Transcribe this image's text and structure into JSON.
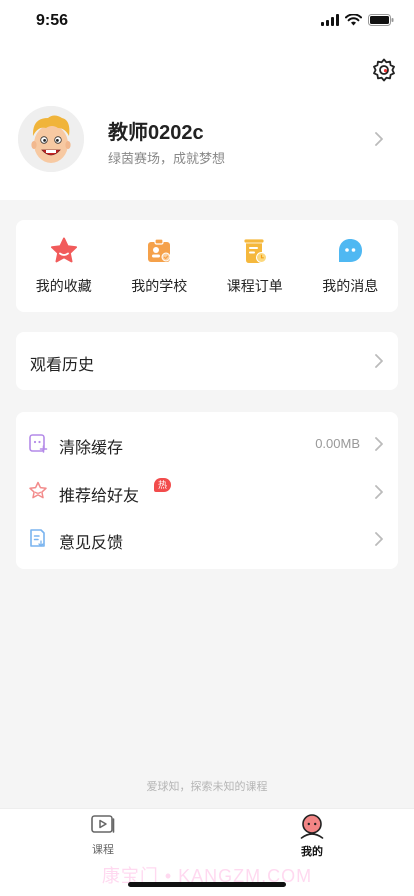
{
  "status_bar": {
    "time": "9:56"
  },
  "profile": {
    "name": "教师0202c",
    "subtitle": "绿茵赛场，成就梦想"
  },
  "quick_actions": [
    {
      "label": "我的收藏",
      "icon": "star-icon",
      "color": "#f15b5b"
    },
    {
      "label": "我的学校",
      "icon": "school-icon",
      "color": "#f5a14a"
    },
    {
      "label": "课程订单",
      "icon": "order-icon",
      "color": "#f5b83d"
    },
    {
      "label": "我的消息",
      "icon": "message-icon",
      "color": "#4fb8f2"
    }
  ],
  "history": {
    "label": "观看历史"
  },
  "settings_list": [
    {
      "label": "清除缓存",
      "value": "0.00MB",
      "icon": "clear-cache-icon"
    },
    {
      "label": "推荐给好友",
      "badge": "热",
      "icon": "share-star-icon"
    },
    {
      "label": "意见反馈",
      "icon": "feedback-icon"
    }
  ],
  "footer": {
    "slogan": "爱球知，探索未知的课程"
  },
  "tabbar": {
    "tabs": [
      {
        "label": "课程",
        "icon": "course-play-icon",
        "active": false
      },
      {
        "label": "我的",
        "icon": "profile-avatar-icon",
        "active": true
      }
    ]
  },
  "watermark": "康宝门 • KANGZM.COM",
  "colors": {
    "accent_red": "#f24c4c",
    "text_primary": "#222222",
    "text_secondary": "#888888",
    "background": "#f5f5f5"
  }
}
